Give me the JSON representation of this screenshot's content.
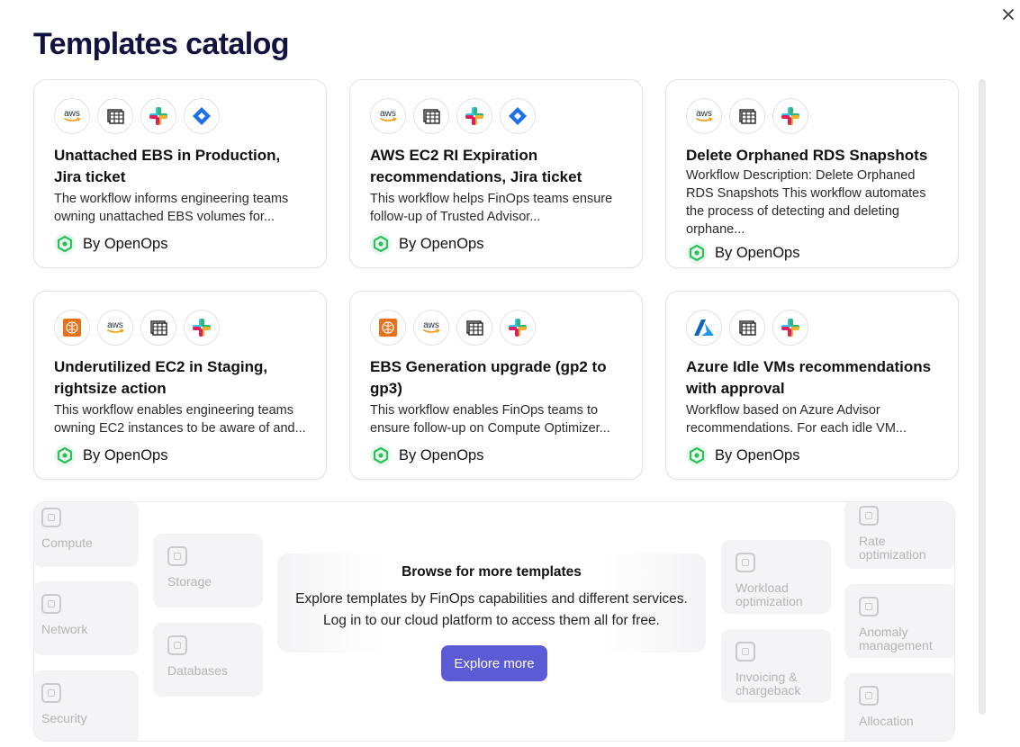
{
  "page": {
    "title": "Templates catalog"
  },
  "cards": [
    {
      "title": "Unattached EBS in Production, Jira ticket",
      "desc": "The workflow informs engineering teams owning unattached EBS volumes for...",
      "by": "By OpenOps",
      "icons": [
        "aws",
        "table",
        "slack",
        "jira"
      ]
    },
    {
      "title": "AWS EC2 RI Expiration recommendations, Jira ticket",
      "desc": "This workflow helps FinOps teams ensure follow-up of Trusted Advisor...",
      "by": "By OpenOps",
      "icons": [
        "aws",
        "table",
        "slack",
        "jira"
      ]
    },
    {
      "title": "Delete Orphaned RDS Snapshots",
      "desc": "Workflow Description: Delete Orphaned RDS Snapshots This workflow automates the process of detecting and deleting orphane...",
      "by": "By OpenOps",
      "icons": [
        "aws",
        "table",
        "slack"
      ]
    },
    {
      "title": "Underutilized EC2 in Staging, rightsize action",
      "desc": "This workflow enables engineering teams owning EC2 instances to be aware of and...",
      "by": "By OpenOps",
      "icons": [
        "brain",
        "aws",
        "table",
        "slack"
      ]
    },
    {
      "title": "EBS Generation upgrade (gp2 to gp3)",
      "desc": "This workflow enables FinOps teams to ensure follow-up on Compute Optimizer...",
      "by": "By OpenOps",
      "icons": [
        "brain",
        "aws",
        "table",
        "slack"
      ]
    },
    {
      "title": "Azure Idle VMs recommendations with approval",
      "desc": "Workflow based on Azure Advisor recommendations. For each idle VM...",
      "by": "By OpenOps",
      "icons": [
        "azure",
        "table",
        "slack"
      ]
    }
  ],
  "browse": {
    "title": "Browse for more templates",
    "line1": "Explore templates by FinOps capabilities and different services.",
    "line2": "Log in to our cloud platform to access them all for free.",
    "button": "Explore more",
    "tiles": {
      "compute": "Compute",
      "network": "Network",
      "security": "Security",
      "storage": "Storage",
      "databases": "Databases",
      "workload": "Workload optimization",
      "invoicing": "Invoicing & chargeback",
      "rate": "Rate optimization",
      "anomaly": "Anomaly management",
      "allocation": "Allocation"
    }
  },
  "colors": {
    "accent": "#5b5bd6",
    "title": "#131340",
    "openops_green": "#2ec05a"
  }
}
